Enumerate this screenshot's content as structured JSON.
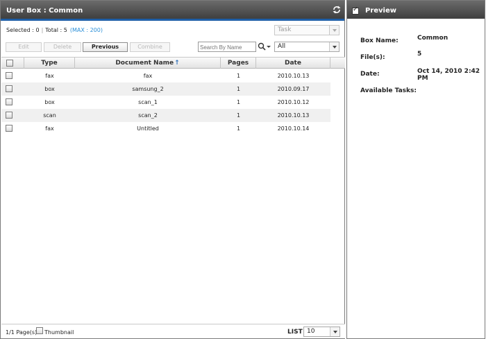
{
  "left_panel": {
    "title": "User Box : Common",
    "selected_text": "Selected : 0",
    "total_text": "Total : 5",
    "max_text": "(MAX : 200)",
    "task_select": "Task",
    "buttons": {
      "edit": "Edit",
      "delete": "Delete",
      "previous": "Previous",
      "combine": "Combine"
    },
    "search": {
      "placeholder": "Search By Name",
      "value": ""
    },
    "filter_select": "All",
    "columns": {
      "type": "Type",
      "name": "Document Name",
      "pages": "Pages",
      "date": "Date"
    },
    "sort_indicator": "↑",
    "rows": [
      {
        "type": "fax",
        "name": "fax",
        "pages": "1",
        "date": "2010.10.13"
      },
      {
        "type": "box",
        "name": "samsung_2",
        "pages": "1",
        "date": "2010.09.17"
      },
      {
        "type": "box",
        "name": "scan_1",
        "pages": "1",
        "date": "2010.10.12"
      },
      {
        "type": "scan",
        "name": "scan_2",
        "pages": "1",
        "date": "2010.10.13"
      },
      {
        "type": "fax",
        "name": "Untitled",
        "pages": "1",
        "date": "2010.10.14"
      }
    ],
    "footer": {
      "page_count": "1/1 Page(s)",
      "thumbnail_label": "Thumbnail",
      "list_label": "LIST",
      "page_size": "10"
    }
  },
  "preview": {
    "title": "Preview",
    "box_name_label": "Box Name:",
    "box_name_value": "Common",
    "files_label": "File(s):",
    "files_value": "5",
    "date_label": "Date:",
    "date_value": "Oct 14, 2010 2:42 PM",
    "tasks_label": "Available Tasks:"
  },
  "colors": {
    "title_bar": "#4f4f4f",
    "accent_line": "#1f5fa8",
    "max_text": "#2a8fd8"
  }
}
